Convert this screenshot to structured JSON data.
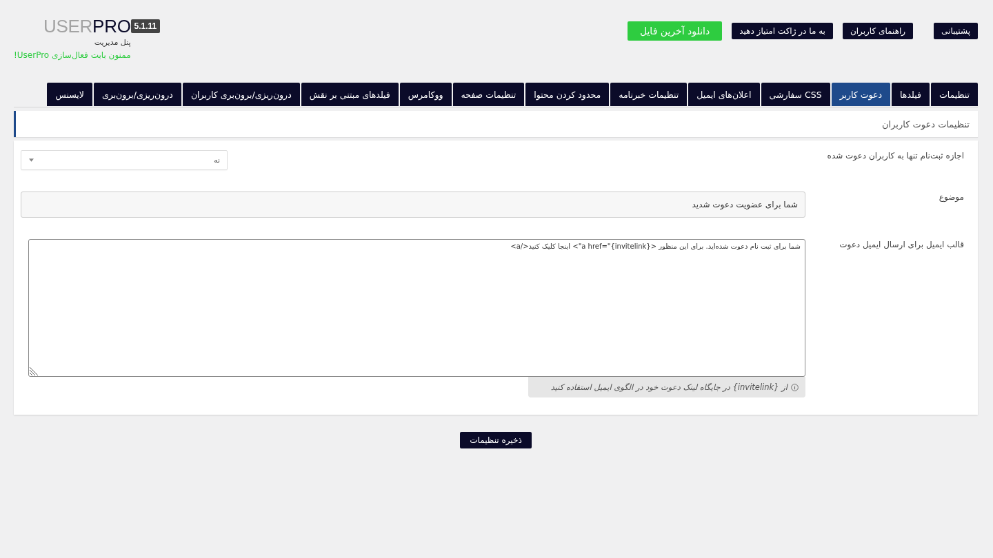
{
  "header": {
    "buttons": [
      {
        "label": "پشتیبانی",
        "kind": "link"
      },
      {
        "label": "راهنمای کاربران",
        "kind": "link"
      },
      {
        "label": "به ما در ژاکت امتیاز دهید",
        "kind": "link"
      },
      {
        "label": "دانلود آخرین فایل",
        "kind": "download"
      }
    ],
    "logo": {
      "light": "USER",
      "dark": "PRO"
    },
    "version": "5.1.11",
    "subtitle": "پنل مدیریت",
    "notice": "ممنون بابت فعال‌سازی UserPro!"
  },
  "tabs": [
    {
      "label": "تنظیمات",
      "selected": false
    },
    {
      "label": "فیلدها",
      "selected": false
    },
    {
      "label": "دعوت کاربر",
      "selected": true
    },
    {
      "label": "CSS سفارشی",
      "selected": false
    },
    {
      "label": "اعلان‌های ایمیل",
      "selected": false
    },
    {
      "label": "تنظیمات خبرنامه",
      "selected": false
    },
    {
      "label": "محدود کردن محتوا",
      "selected": false
    },
    {
      "label": "تنظیمات صفحه",
      "selected": false
    },
    {
      "label": "ووکامرس",
      "selected": false
    },
    {
      "label": "فیلدهای مبتنی بر نقش",
      "selected": false
    },
    {
      "label": "درون‌ریزی/برون‌بری کاربران",
      "selected": false
    },
    {
      "label": "درون‌ریزی/برون‌بری",
      "selected": false
    },
    {
      "label": "لایسنس",
      "selected": false
    }
  ],
  "section": {
    "title": "تنظیمات دعوت کاربران"
  },
  "fields": [
    {
      "kind": "select",
      "label": "اجازه ثبت‌نام تنها به کاربران دعوت شده",
      "value": "نه"
    },
    {
      "kind": "input",
      "label": "موضوع",
      "value": "شما برای عضویت دعوت شدید"
    },
    {
      "kind": "textarea",
      "label": "قالب ایمیل برای ارسال ایمیل دعوت",
      "value": "شما برای ثبت نام دعوت شده‌اید. برای این منظور <a href=\"{invitelink}\"> اینجا کلیک کنید</a>",
      "hint": "از {invitelink} در جایگاه لینک دعوت خود در الگوی ایمیل استفاده کنید"
    }
  ],
  "save_button": "ذخیره تنظیمات"
}
